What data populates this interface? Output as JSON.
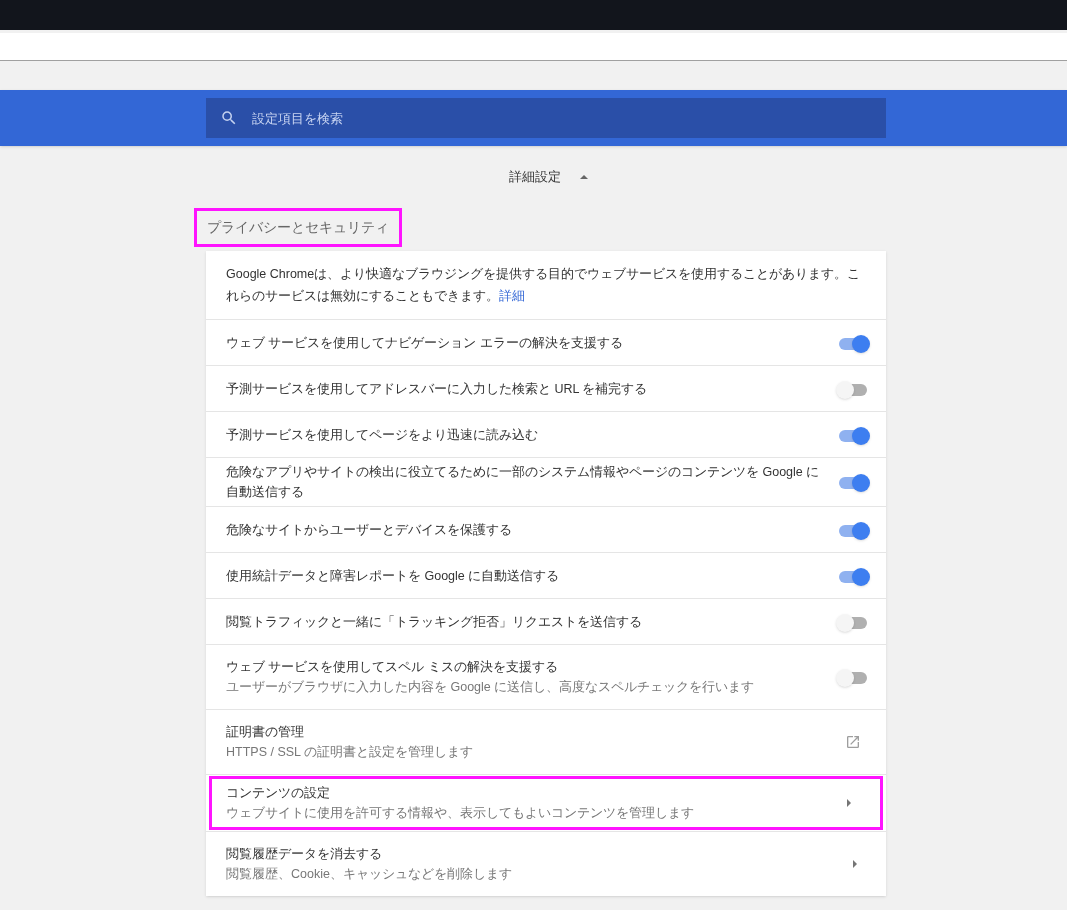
{
  "search": {
    "placeholder": "設定項目を検索"
  },
  "advanced": {
    "label": "詳細設定",
    "expanded": true
  },
  "section": {
    "title": "プライバシーとセキュリティ",
    "highlighted": true
  },
  "intro": {
    "text": "Google Chromeは、より快適なブラウジングを提供する目的でウェブサービスを使用することがあります。これらのサービスは無効にすることもできます。",
    "link": "詳細"
  },
  "rows": [
    {
      "kind": "toggle",
      "label": "ウェブ サービスを使用してナビゲーション エラーの解決を支援する",
      "on": true,
      "highlighted": false
    },
    {
      "kind": "toggle",
      "label": "予測サービスを使用してアドレスバーに入力した検索と URL を補完する",
      "on": false,
      "highlighted": false
    },
    {
      "kind": "toggle",
      "label": "予測サービスを使用してページをより迅速に読み込む",
      "on": true,
      "highlighted": false
    },
    {
      "kind": "toggle",
      "label": "危険なアプリやサイトの検出に役立てるために一部のシステム情報やページのコンテンツを Google に自動送信する",
      "on": true,
      "highlighted": false
    },
    {
      "kind": "toggle",
      "label": "危険なサイトからユーザーとデバイスを保護する",
      "on": true,
      "highlighted": false
    },
    {
      "kind": "toggle",
      "label": "使用統計データと障害レポートを Google に自動送信する",
      "on": true,
      "highlighted": false
    },
    {
      "kind": "toggle",
      "label": "閲覧トラフィックと一緒に「トラッキング拒否」リクエストを送信する",
      "on": false,
      "highlighted": false
    },
    {
      "kind": "toggle",
      "label": "ウェブ サービスを使用してスペル ミスの解決を支援する",
      "sublabel": "ユーザーがブラウザに入力した内容を Google に送信し、高度なスペルチェックを行います",
      "on": false,
      "highlighted": false
    },
    {
      "kind": "external",
      "label": "証明書の管理",
      "sublabel": "HTTPS / SSL の証明書と設定を管理します",
      "highlighted": false
    },
    {
      "kind": "arrow",
      "label": "コンテンツの設定",
      "sublabel": "ウェブサイトに使用を許可する情報や、表示してもよいコンテンツを管理します",
      "highlighted": true
    },
    {
      "kind": "arrow",
      "label": "閲覧履歴データを消去する",
      "sublabel": "閲覧履歴、Cookie、キャッシュなどを削除します",
      "highlighted": false
    }
  ]
}
